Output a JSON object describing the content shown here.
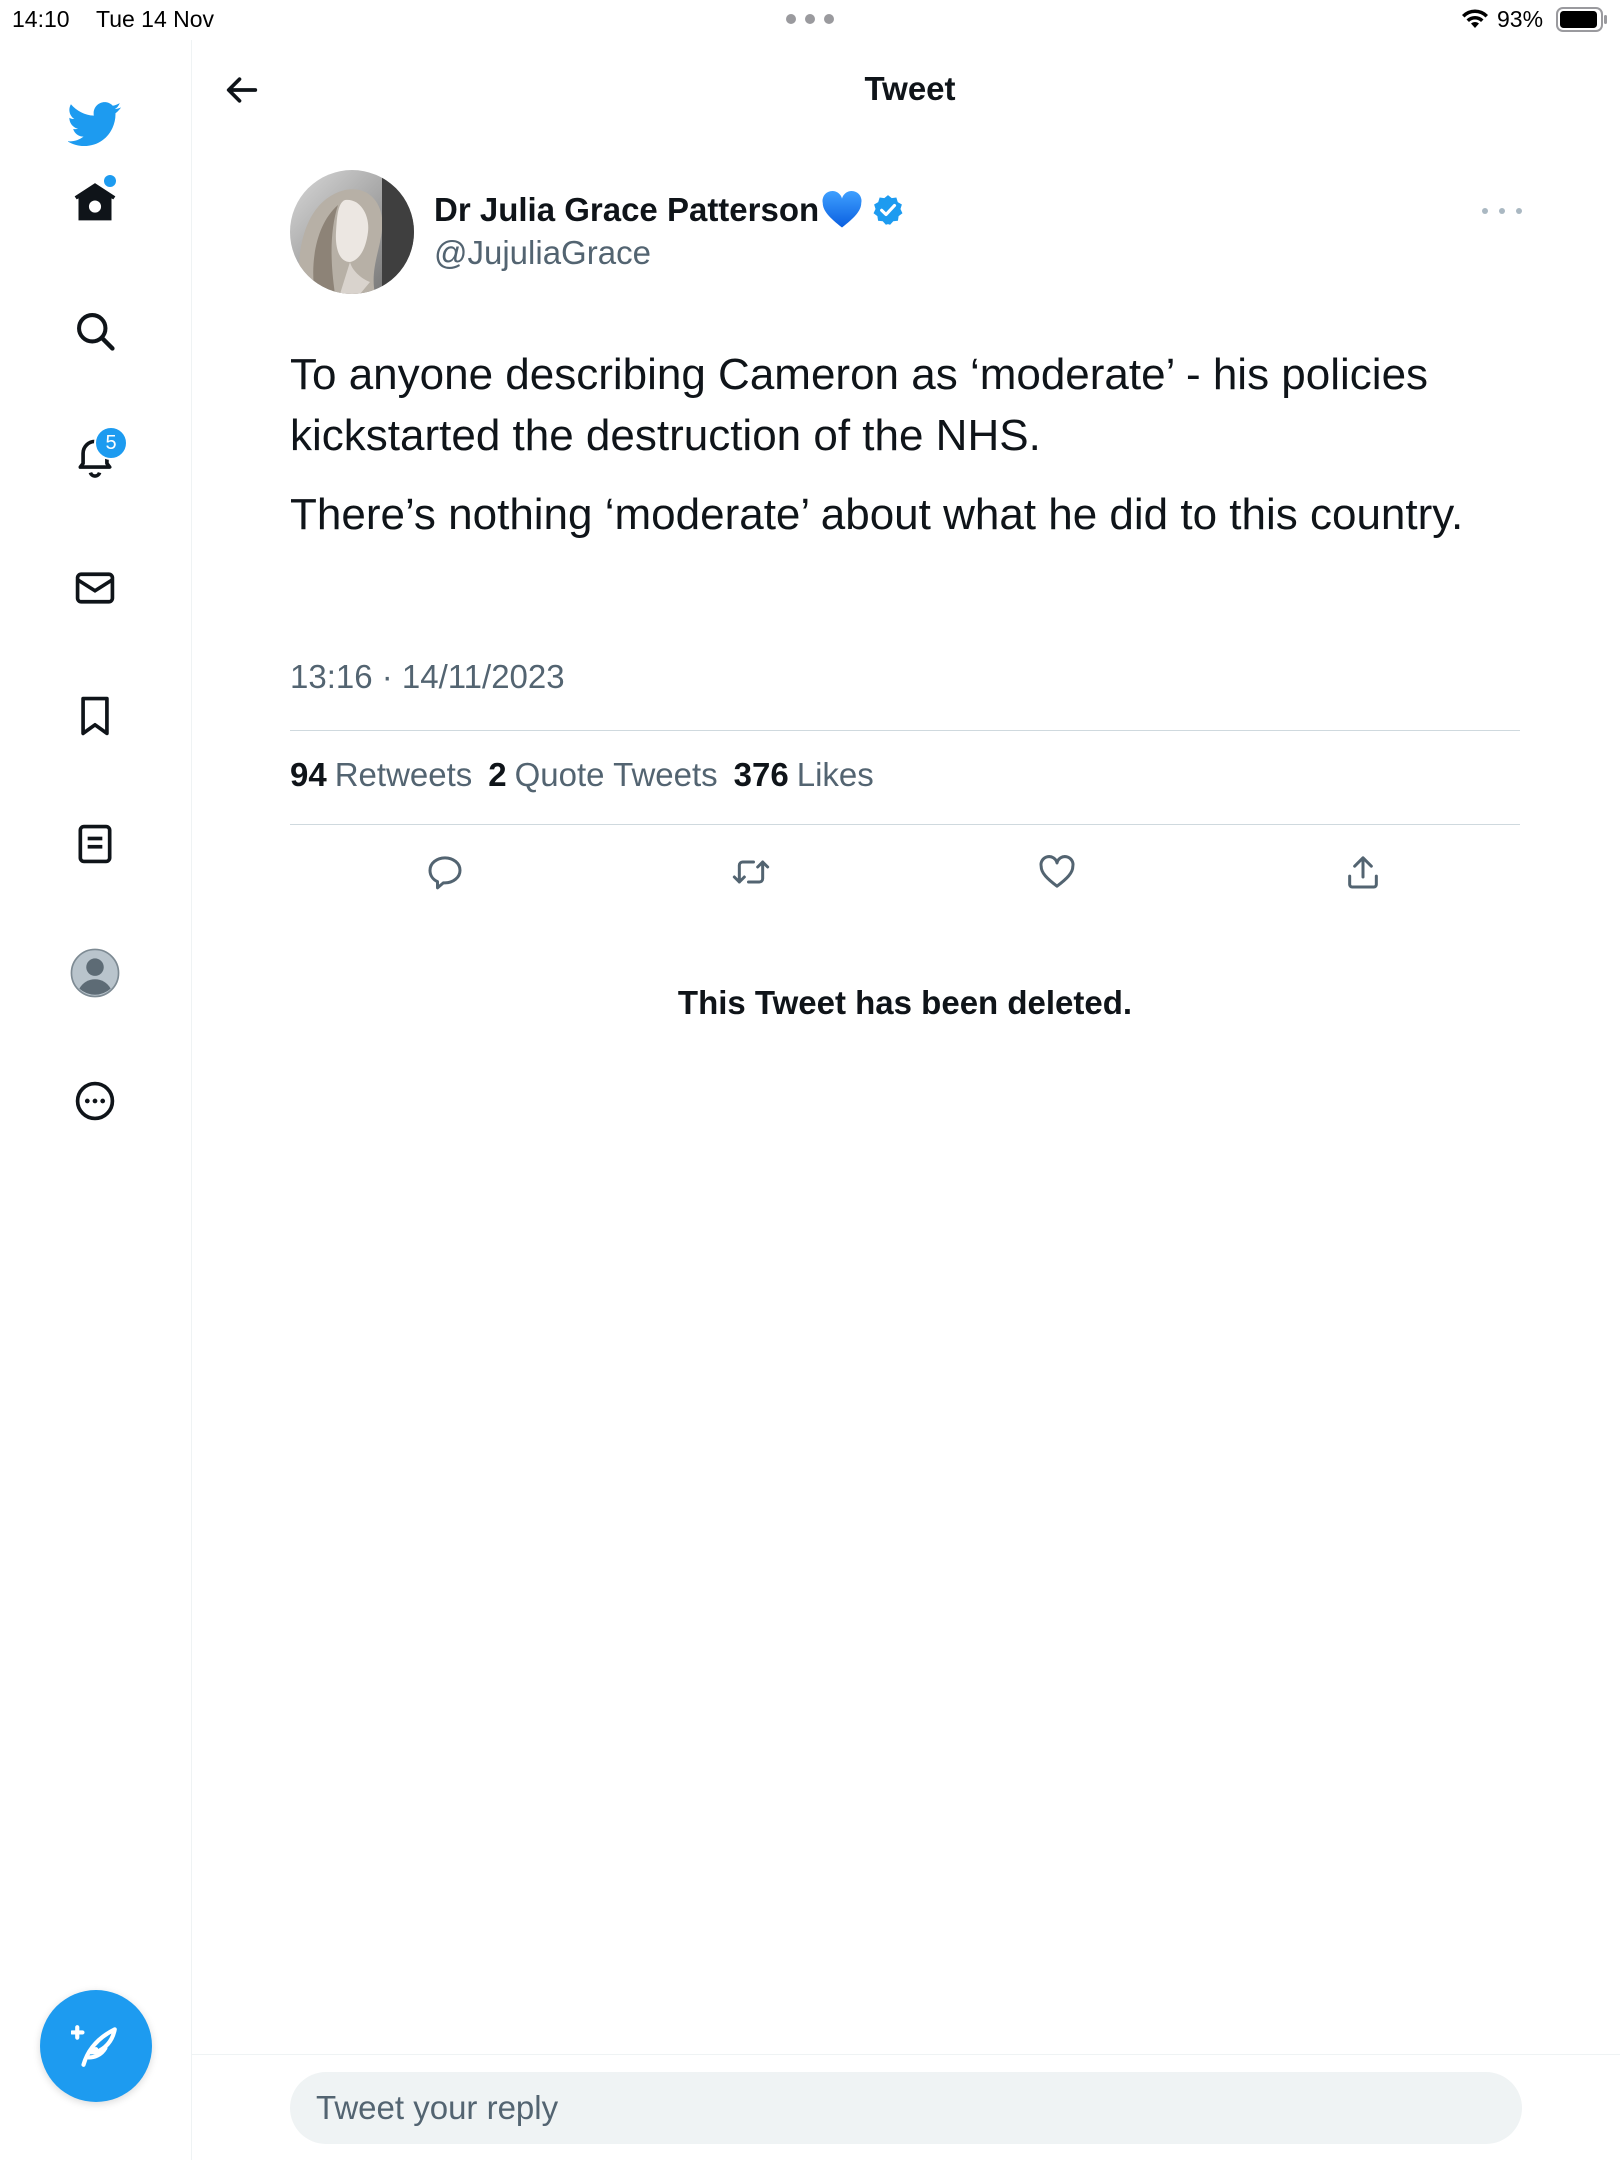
{
  "status_bar": {
    "time": "14:10",
    "date": "Tue 14 Nov",
    "battery": "93%"
  },
  "sidebar": {
    "items": [
      {
        "name": "twitter-logo",
        "icon": "bird-icon"
      },
      {
        "name": "home",
        "icon": "home-icon",
        "has_dot": true
      },
      {
        "name": "explore",
        "icon": "search-icon"
      },
      {
        "name": "notifications",
        "icon": "bell-icon",
        "badge": "5"
      },
      {
        "name": "messages",
        "icon": "envelope-icon"
      },
      {
        "name": "bookmarks",
        "icon": "bookmark-icon"
      },
      {
        "name": "lists",
        "icon": "list-icon"
      },
      {
        "name": "profile",
        "icon": "avatar-icon"
      },
      {
        "name": "more",
        "icon": "more-circle-icon"
      }
    ],
    "compose_icon": "compose-feather-icon"
  },
  "header": {
    "title": "Tweet"
  },
  "tweet": {
    "author_name": "Dr Julia Grace Patterson",
    "author_emoji": "blue-heart",
    "verified": true,
    "handle": "@JujuliaGrace",
    "text_paragraphs": [
      "To anyone describing Cameron as ‘moderate’ - his policies kickstarted the destruction of the NHS.",
      "There’s nothing ‘moderate’ about what he did to this country."
    ],
    "timestamp": "13:16 · 14/11/2023",
    "stats": {
      "retweets_count": "94",
      "retweets_label": "Retweets",
      "quotes_count": "2",
      "quotes_label": "Quote Tweets",
      "likes_count": "376",
      "likes_label": "Likes"
    },
    "actions": [
      "reply-icon",
      "retweet-icon",
      "like-icon",
      "share-icon"
    ]
  },
  "deleted_notice": "This Tweet has been deleted.",
  "reply": {
    "placeholder": "Tweet your reply"
  },
  "colors": {
    "accent": "#1d9bf0",
    "text": "#0f1419",
    "secondary": "#536471",
    "divider": "#cfd9de"
  }
}
